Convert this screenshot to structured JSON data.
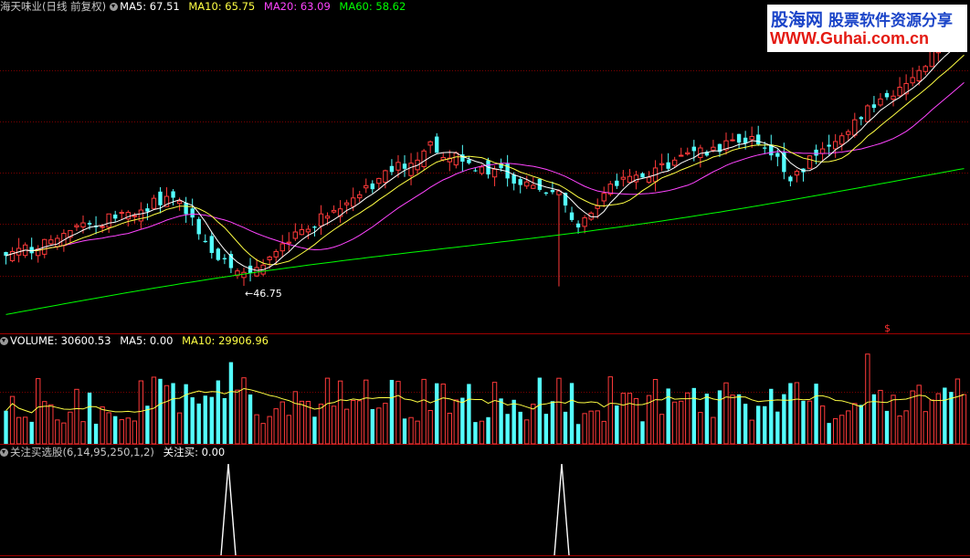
{
  "header_main": {
    "title": "海天味业(日线 前复权)",
    "ma5_label": "MA5: 67.51",
    "ma10_label": "MA10: 65.75",
    "ma20_label": "MA20: 63.09",
    "ma60_label": "MA60: 58.62"
  },
  "header_volume": {
    "volume_label": "VOLUME: 30600.53",
    "ma5_label": "MA5: 0.00",
    "ma10_label": "MA10: 29906.96"
  },
  "header_indicator": {
    "name_label": "关注买选股(6,14,95,250,1,2)",
    "value_label": "关注买: 0.00"
  },
  "logo": {
    "line1": "股海网",
    "line1b": "股票软件资源分享",
    "line2": "WWW.Guhai.com.cn"
  },
  "colors": {
    "background": "#000000",
    "grid": "#7a0000",
    "up": "#ff3a3a",
    "down": "#54ffff",
    "ma5": "#ffffff",
    "ma10": "#ffff44",
    "ma20": "#ff44ff",
    "ma60": "#00ff00",
    "indicator": "#ffffff"
  },
  "chart_data": {
    "type": "candlestick",
    "low_annotation": "46.75",
    "low_marker": "$",
    "indicator_signal_count": 2
  }
}
